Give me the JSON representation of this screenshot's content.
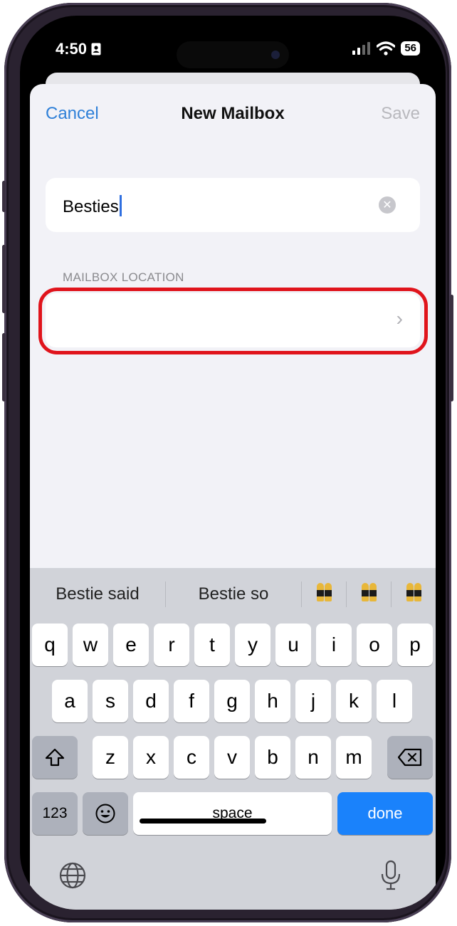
{
  "status_bar": {
    "time": "4:50",
    "battery": "56"
  },
  "nav": {
    "cancel": "Cancel",
    "title": "New Mailbox",
    "save": "Save"
  },
  "name_field": {
    "value": "Besties"
  },
  "location": {
    "section_label": "MAILBOX LOCATION",
    "value": ""
  },
  "keyboard": {
    "suggestions": [
      "Bestie said",
      "Bestie so"
    ],
    "emoji_suggestions": [
      "dancers-emoji",
      "dancers-emoji",
      "dancers-emoji"
    ],
    "row1": [
      "q",
      "w",
      "e",
      "r",
      "t",
      "y",
      "u",
      "i",
      "o",
      "p"
    ],
    "row2": [
      "a",
      "s",
      "d",
      "f",
      "g",
      "h",
      "j",
      "k",
      "l"
    ],
    "row3": [
      "z",
      "x",
      "c",
      "v",
      "b",
      "n",
      "m"
    ],
    "numbers_key": "123",
    "space_key": "space",
    "done_key": "done"
  },
  "colors": {
    "accent": "#2f80d8",
    "highlight": "#e0141c",
    "done_key": "#1a82fb"
  }
}
